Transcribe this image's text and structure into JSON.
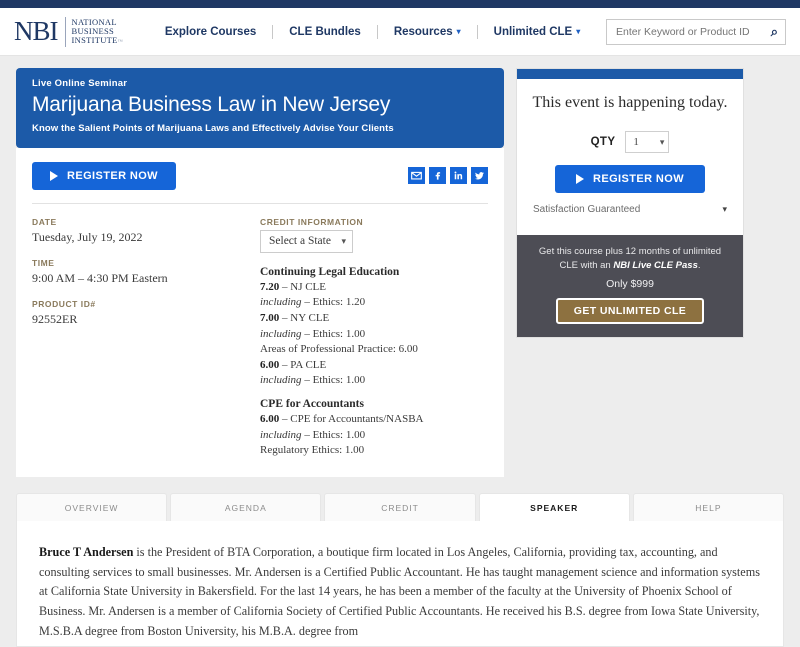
{
  "header": {
    "logo": {
      "mark": "NBI",
      "lines": [
        "NATIONAL",
        "BUSINESS",
        "INSTITUTE"
      ],
      "tm": "™"
    },
    "nav": [
      {
        "label": "Explore Courses",
        "has_caret": false
      },
      {
        "label": "CLE Bundles",
        "has_caret": false
      },
      {
        "label": "Resources",
        "has_caret": true
      },
      {
        "label": "Unlimited CLE",
        "has_caret": true
      }
    ],
    "search": {
      "placeholder": "Enter Keyword or Product ID",
      "value": "",
      "icon": "search-icon"
    }
  },
  "hero": {
    "kicker": "Live Online Seminar",
    "title": "Marijuana Business Law in New Jersey",
    "subtitle": "Know the Salient Points of Marijuana Laws and Effectively Advise Your Clients"
  },
  "card": {
    "register_label": "REGISTER NOW",
    "socials": [
      "email-icon",
      "facebook-icon",
      "linkedin-icon",
      "twitter-icon"
    ],
    "details": [
      {
        "label": "DATE",
        "value": "Tuesday, July 19, 2022",
        "selected": true
      },
      {
        "label": "TIME",
        "value": "9:00 AM – 4:30 PM Eastern",
        "selected": false
      },
      {
        "label": "PRODUCT ID#",
        "value": "92552ER",
        "selected": false
      }
    ],
    "credit": {
      "label": "CREDIT INFORMATION",
      "state_select": "Select a State",
      "groups": [
        {
          "heading": "Continuing Legal Education",
          "lines": [
            {
              "amount": "7.20",
              "text": " – NJ CLE",
              "italic": ""
            },
            {
              "amount": "",
              "italic": "including",
              "text": " – Ethics: 1.20"
            },
            {
              "amount": "7.00",
              "text": " – NY CLE",
              "italic": ""
            },
            {
              "amount": "",
              "italic": "including",
              "text": " – Ethics: 1.00"
            },
            {
              "amount": "",
              "italic": "",
              "text": "Areas of Professional Practice: 6.00"
            },
            {
              "amount": "6.00",
              "text": " – PA CLE",
              "italic": ""
            },
            {
              "amount": "",
              "italic": "including",
              "text": " – Ethics: 1.00"
            }
          ]
        },
        {
          "heading": "CPE for Accountants",
          "lines": [
            {
              "amount": "6.00",
              "text": " – CPE for Accountants/NASBA",
              "italic": ""
            },
            {
              "amount": "",
              "italic": "including",
              "text": " – Ethics: 1.00"
            },
            {
              "amount": "",
              "italic": "",
              "text": "Regulatory Ethics: 1.00"
            }
          ]
        }
      ]
    }
  },
  "sidebar": {
    "headline": "This event is happening today.",
    "qty_label": "QTY",
    "qty_value": "1",
    "register_label": "REGISTER NOW",
    "satisfaction_label": "Satisfaction Guaranteed",
    "promo": {
      "line_pre": "Get this course plus 12 months of unlimited CLE with an ",
      "line_em": "NBI Live CLE Pass",
      "line_post": ".",
      "price": "Only $999",
      "button": "GET UNLIMITED CLE"
    }
  },
  "tabs": [
    {
      "label": "OVERVIEW",
      "active": false
    },
    {
      "label": "AGENDA",
      "active": false
    },
    {
      "label": "CREDIT",
      "active": false
    },
    {
      "label": "SPEAKER",
      "active": true
    },
    {
      "label": "HELP",
      "active": false
    }
  ],
  "speaker": {
    "name": "Bruce T Andersen",
    "bio": " is the President of BTA Corporation, a boutique firm located in Los Angeles, California, providing tax, accounting, and consulting services to small businesses. Mr. Andersen is a Certified Public Accountant. He has taught management science and information systems at California State University in Bakersfield. For the last 14 years, he has been a member of the faculty at the University of Phoenix School of Business. Mr. Andersen is a member of California Society of Certified Public Accountants. He received his B.S. degree from Iowa State University, M.S.B.A degree from Boston University, his M.B.A. degree from"
  },
  "colors": {
    "brand_navy": "#1f3864",
    "hero_blue": "#1c5aa8",
    "button_blue": "#1565d8",
    "gold": "#8d7140",
    "promo_bg": "#4d4d55",
    "page_bg": "#ededed",
    "label_tan": "#8a7a5c"
  }
}
